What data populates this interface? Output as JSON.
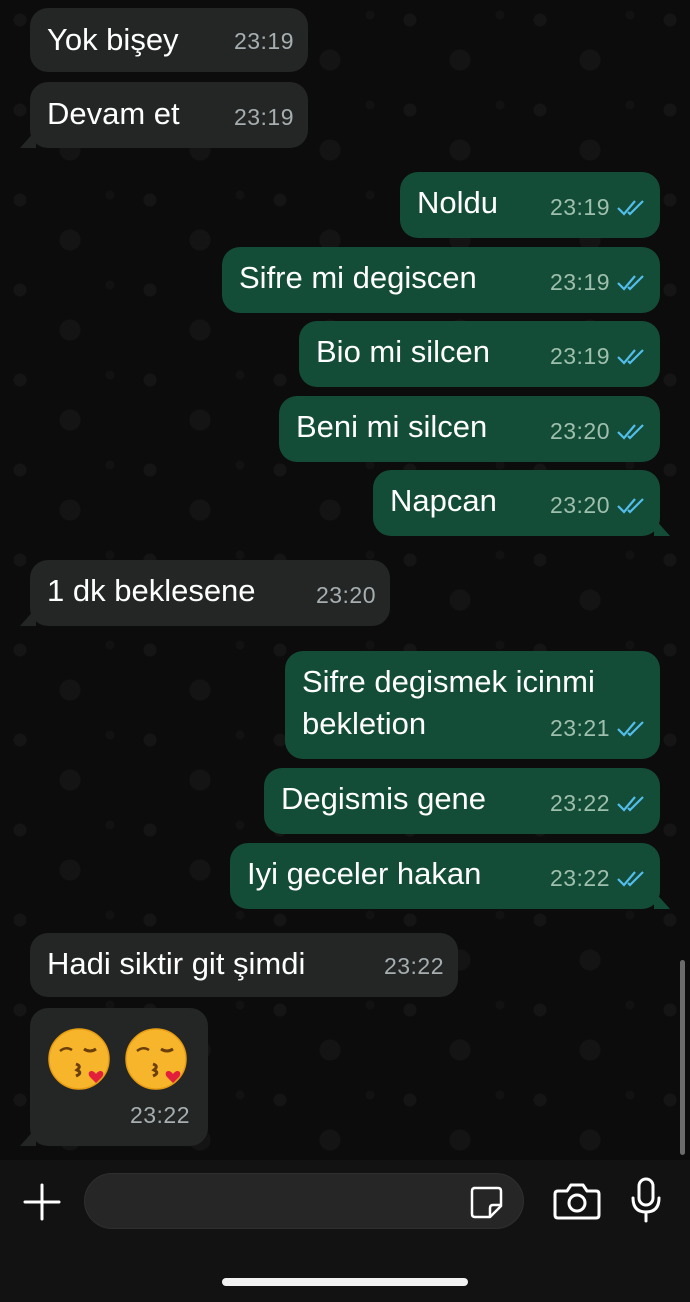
{
  "messages": [
    {
      "dir": "in",
      "text": "Yok bişey",
      "time": "23:19"
    },
    {
      "dir": "in",
      "text": "Devam et",
      "time": "23:19"
    },
    {
      "dir": "out",
      "text": "Noldu",
      "time": "23:19",
      "read": true
    },
    {
      "dir": "out",
      "text": "Sifre mi degiscen",
      "time": "23:19",
      "read": true
    },
    {
      "dir": "out",
      "text": "Bio mi silcen",
      "time": "23:19",
      "read": true
    },
    {
      "dir": "out",
      "text": "Beni mi silcen",
      "time": "23:20",
      "read": true
    },
    {
      "dir": "out",
      "text": "Napcan",
      "time": "23:20",
      "read": true
    },
    {
      "dir": "in",
      "text": "1 dk beklesene",
      "time": "23:20"
    },
    {
      "dir": "out",
      "text": "Sifre degismek icinmi bekletion",
      "time": "23:21",
      "read": true
    },
    {
      "dir": "out",
      "text": "Degismis gene",
      "time": "23:22",
      "read": true
    },
    {
      "dir": "out",
      "text": "Iyi geceler hakan",
      "time": "23:22",
      "read": true
    },
    {
      "dir": "in",
      "text": "Hadi siktir git şimdi",
      "time": "23:22"
    },
    {
      "dir": "in",
      "emoji": [
        "face-blowing-a-kiss",
        "face-blowing-a-kiss"
      ],
      "time": "23:22"
    }
  ],
  "composer": {
    "placeholder": "",
    "icons": [
      "plus-icon",
      "sticker-icon",
      "camera-icon",
      "microphone-icon"
    ]
  },
  "colors": {
    "incoming_bubble": "#242626",
    "outgoing_bubble": "#134d37",
    "read_tick": "#53bdeb",
    "background": "#0c0c0c"
  }
}
